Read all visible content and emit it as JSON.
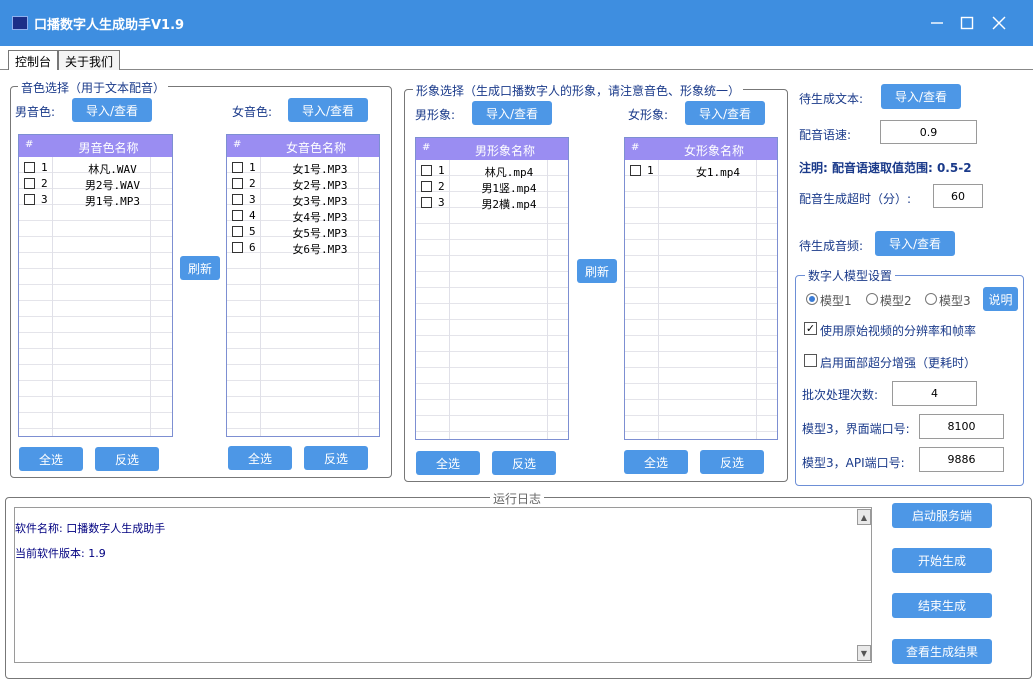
{
  "window": {
    "title": "口播数字人生成助手V1.9",
    "icon": "app-icon",
    "controls": [
      "minimize-icon",
      "maximize-icon",
      "close-icon"
    ]
  },
  "tabs": [
    {
      "label": "控制台",
      "active": true
    },
    {
      "label": "关于我们",
      "active": false
    }
  ],
  "voice": {
    "legend": "音色选择（用于文本配音）",
    "male_label": "男音色:",
    "female_label": "女音色:",
    "import_label": "导入/查看",
    "refresh_label": "刷新",
    "male_header": "男音色名称",
    "female_header": "女音色名称",
    "male_items": [
      "林凡.WAV",
      "男2号.WAV",
      "男1号.MP3"
    ],
    "female_items": [
      "女1号.MP3",
      "女2号.MP3",
      "女3号.MP3",
      "女4号.MP3",
      "女5号.MP3",
      "女6号.MP3"
    ],
    "select_all": "全选",
    "invert": "反选"
  },
  "avatar": {
    "legend": "形象选择（生成口播数字人的形象，请注意音色、形象统一）",
    "male_label": "男形象:",
    "female_label": "女形象:",
    "import_label": "导入/查看",
    "refresh_label": "刷新",
    "male_header": "男形象名称",
    "female_header": "女形象名称",
    "male_items": [
      "林凡.mp4",
      "男1竖.mp4",
      "男2横.mp4"
    ],
    "female_items": [
      "女1.mp4"
    ],
    "select_all": "全选",
    "invert": "反选"
  },
  "settings": {
    "text_label": "待生成文本:",
    "text_button": "导入/查看",
    "speed_label": "配音语速:",
    "speed_value": "0.9",
    "speed_note": "注明: 配音语速取值范围: 0.5-2",
    "timeout_label": "配音生成超时（分）:",
    "timeout_value": "60",
    "audio_label": "待生成音频:",
    "audio_button": "导入/查看"
  },
  "model": {
    "legend": "数字人模型设置",
    "options": [
      "模型1",
      "模型2",
      "模型3"
    ],
    "selected": "模型1",
    "help_label": "说明",
    "use_original_label": "使用原始视频的分辨率和帧率",
    "use_original_checked": true,
    "face_enhance_label": "启用面部超分增强（更耗时）",
    "face_enhance_checked": false,
    "batch_label": "批次处理次数:",
    "batch_value": "4",
    "ui_port_label": "模型3，界面端口号:",
    "ui_port_value": "8100",
    "api_port_label": "模型3，API端口号:",
    "api_port_value": "9886"
  },
  "log": {
    "legend": "运行日志",
    "lines": [
      "软件名称: 口播数字人生成助手",
      "当前软件版本: 1.9"
    ]
  },
  "actions": {
    "start_server": "启动服务端",
    "start_generate": "开始生成",
    "stop_generate": "结束生成",
    "view_results": "查看生成结果"
  },
  "colors": {
    "titlebar": "#3e8ee0",
    "button": "#4d97e6",
    "grid_header": "#9a8df2",
    "label_text": "#1a3a8a"
  }
}
